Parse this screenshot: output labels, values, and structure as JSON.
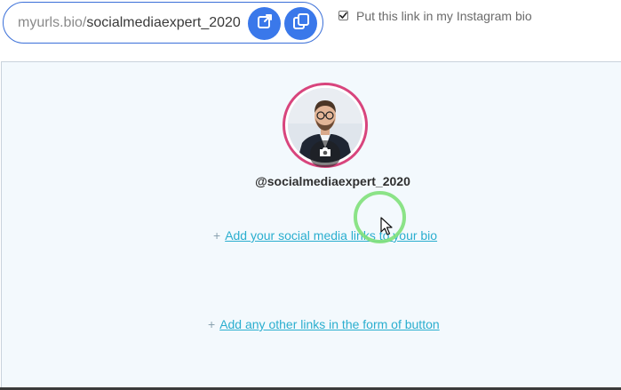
{
  "link_bar": {
    "domain": "myurls.bio/",
    "slug": "socialmediaexpert_2020",
    "open_icon": "external-link-icon",
    "copy_icon": "copy-icon"
  },
  "instagram_option": {
    "checked": true,
    "label": "Put this link in my Instagram bio"
  },
  "profile": {
    "username": "@socialmediaexpert_2020",
    "avatar_ring_color": "#d8457d",
    "avatar_badge_icon": "camera-icon"
  },
  "actions": {
    "plus": "+",
    "add_social_label": "Add your social media links to your bio",
    "add_other_label": "Add any other links in the form of button"
  },
  "colors": {
    "accent": "#3a78ea",
    "link": "#2aaecf",
    "panel_bg": "#f3f9fd"
  }
}
